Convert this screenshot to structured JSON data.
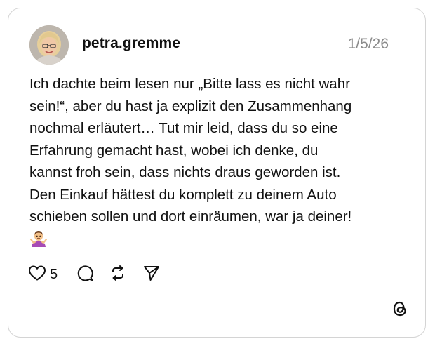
{
  "post": {
    "username": "petra.gremme",
    "date": "1/5/26",
    "avatar_icon": "user-avatar-photo",
    "text": "Ich dachte beim lesen nur „Bitte lass es nicht wahr\nsein!“, aber du hast ja explizit den Zusammenhang\nnochmal erläutert… Tut mir leid, dass du so eine\nErfahrung gemacht hast, wobei ich denke, du\nkannst froh sein, dass nichts draus geworden ist.\nDen Einkauf hättest du komplett zu deinem Auto\nschieben sollen und dort einräumen, war ja deiner!",
    "emoji_icon": "person-shrugging-emoji"
  },
  "actions": {
    "like_icon": "heart-icon",
    "like_count": "5",
    "comment_icon": "comment-icon",
    "repost_icon": "repost-icon",
    "share_icon": "send-icon"
  },
  "brand": {
    "logo_icon": "threads-logo-icon",
    "accent": "#111111",
    "muted": "#8a8a8a",
    "border": "#d4d4d4"
  }
}
